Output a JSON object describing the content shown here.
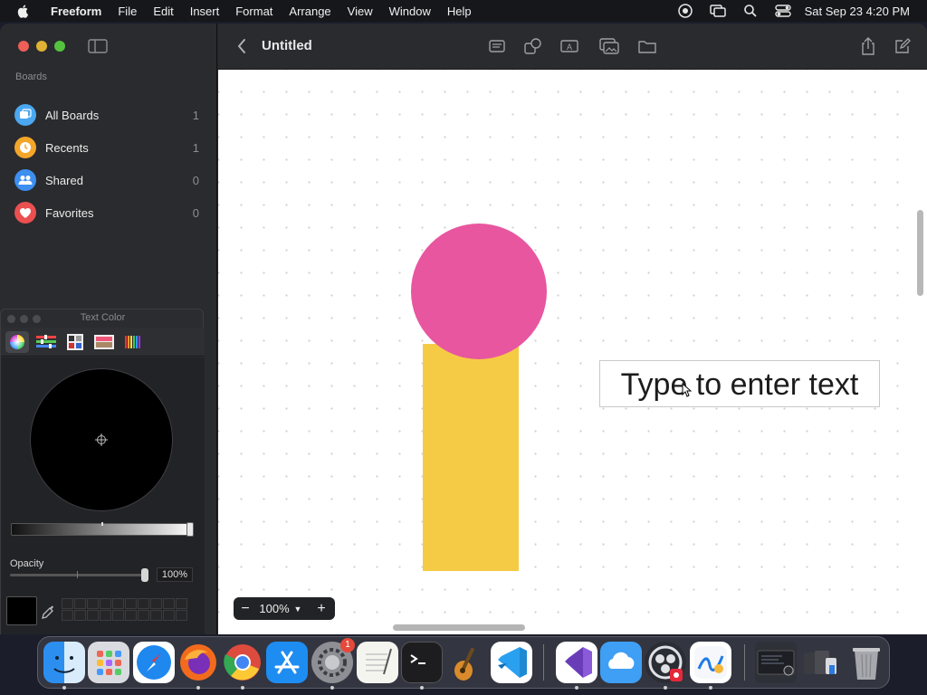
{
  "menubar": {
    "app_name": "Freeform",
    "items": [
      "File",
      "Edit",
      "Insert",
      "Format",
      "Arrange",
      "View",
      "Window",
      "Help"
    ],
    "clock": "Sat Sep 23  4:20 PM"
  },
  "sidebar": {
    "heading": "Boards",
    "boards": [
      {
        "label": "All Boards",
        "count": "1",
        "icon": "boards-icon",
        "color": "#4aa7f0"
      },
      {
        "label": "Recents",
        "count": "1",
        "icon": "clock-icon",
        "color": "#f4a62a"
      },
      {
        "label": "Shared",
        "count": "0",
        "icon": "people-icon",
        "color": "#3d8ff0"
      },
      {
        "label": "Favorites",
        "count": "0",
        "icon": "heart-icon",
        "color": "#eb4f4f"
      }
    ]
  },
  "color_panel": {
    "title": "Text Color",
    "opacity_label": "Opacity",
    "opacity_value": "100%",
    "brightness_fraction": 0.96,
    "opacity_fraction": 1.0,
    "current_color": "#000000"
  },
  "toolbar": {
    "title": "Untitled"
  },
  "canvas": {
    "text_box": "Type to enter text",
    "shapes": [
      {
        "type": "circle",
        "color": "#e8569f"
      },
      {
        "type": "rectangle",
        "color": "#f5cb45"
      }
    ]
  },
  "zoom": {
    "value": "100%",
    "out_label": "−",
    "in_label": "+"
  },
  "dock": {
    "apps": [
      "Finder",
      "Launchpad",
      "Safari",
      "Firefox",
      "Chrome",
      "App Store",
      "System Settings",
      "TextEdit",
      "Terminal",
      "GarageBand",
      "Visual Studio Code",
      "Visual Studio",
      "iCloud",
      "OBS",
      "Freeform"
    ],
    "settings_badge": "1"
  }
}
